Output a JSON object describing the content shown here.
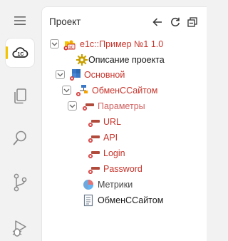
{
  "panel": {
    "title": "Проект"
  },
  "tree": {
    "root_label": "e1c::Пример №1 1.0",
    "project_description": "Описание проекта",
    "main": "Основной",
    "module": "ОбменССайтом",
    "params": "Параметры",
    "param_items": [
      "URL",
      "API",
      "Login",
      "Password"
    ],
    "metrics": "Метрики",
    "module_file": "ОбменССайтом"
  },
  "colors": {
    "accent": "#f5c400",
    "brand_red": "#c7342b",
    "field_bar": "#b04a3a"
  }
}
